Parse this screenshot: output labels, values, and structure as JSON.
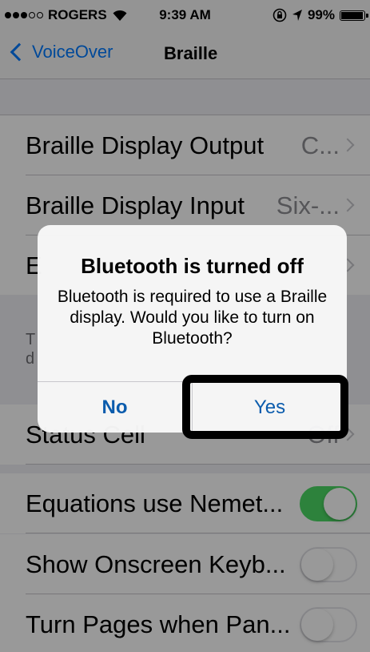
{
  "status_bar": {
    "carrier": "ROGERS",
    "time": "9:39 AM",
    "battery": "99%",
    "signal_filled": 3,
    "signal_total": 5,
    "battery_level": 0.99
  },
  "nav": {
    "back_label": "VoiceOver",
    "title": "Braille"
  },
  "rows": [
    {
      "label": "Braille Display Output",
      "detail": "C...",
      "chevron": true
    },
    {
      "label": "Braille Display Input",
      "detail": "Six-...",
      "chevron": true
    },
    {
      "label": "E",
      "detail": "",
      "chevron": true
    }
  ],
  "footer_partial": {
    "line1": "T",
    "line2": "d"
  },
  "toggle_rows": [
    {
      "label": "Status Cell",
      "detail": "Off"
    },
    {
      "label": "Equations use Nemet...",
      "on": true
    },
    {
      "label": "Show Onscreen Keyb...",
      "on": false
    },
    {
      "label": "Turn Pages when Pan...",
      "on": false
    }
  ],
  "alert": {
    "title": "Bluetooth is turned off",
    "message": "Bluetooth is required to use a Braille display. Would you like to turn on Bluetooth?",
    "no_label": "No",
    "yes_label": "Yes"
  },
  "colors": {
    "accent": "#007aff",
    "alert_button": "#0b5cad",
    "toggle_on": "#4cd964",
    "highlight": "#000000"
  },
  "icons": {
    "back": "chevron-left-icon",
    "wifi": "wifi-icon",
    "rotation_lock": "rotation-lock-icon",
    "location": "location-arrow-icon",
    "battery": "battery-icon",
    "disclosure": "chevron-right-icon"
  }
}
